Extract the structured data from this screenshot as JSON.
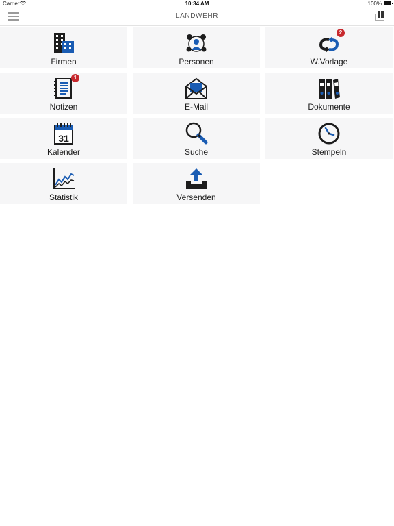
{
  "status_bar": {
    "carrier": "Carrier",
    "time": "10:34 AM",
    "battery": "100%"
  },
  "nav": {
    "title": "LANDWEHR",
    "menu_icon": "hamburger-menu-icon",
    "right_icon": "columns-icon"
  },
  "colors": {
    "accent_blue": "#1a5cb3",
    "icon_dark": "#1d1d1d",
    "badge_red": "#c7282d",
    "tile_bg": "#f6f6f7"
  },
  "tiles": [
    {
      "label": "Firmen",
      "icon": "buildings-icon"
    },
    {
      "label": "Personen",
      "icon": "people-network-icon"
    },
    {
      "label": "W.Vorlage",
      "icon": "resubmission-arrows-icon",
      "badge": "2"
    },
    {
      "label": "Notizen",
      "icon": "notepad-icon",
      "badge": "1"
    },
    {
      "label": "E-Mail",
      "icon": "envelope-icon"
    },
    {
      "label": "Dokumente",
      "icon": "binders-icon"
    },
    {
      "label": "Kalender",
      "icon": "calendar-icon",
      "calendar_day": "31"
    },
    {
      "label": "Suche",
      "icon": "magnifier-icon"
    },
    {
      "label": "Stempeln",
      "icon": "clock-icon"
    },
    {
      "label": "Statistik",
      "icon": "line-chart-icon"
    },
    {
      "label": "Versenden",
      "icon": "upload-tray-icon"
    }
  ]
}
